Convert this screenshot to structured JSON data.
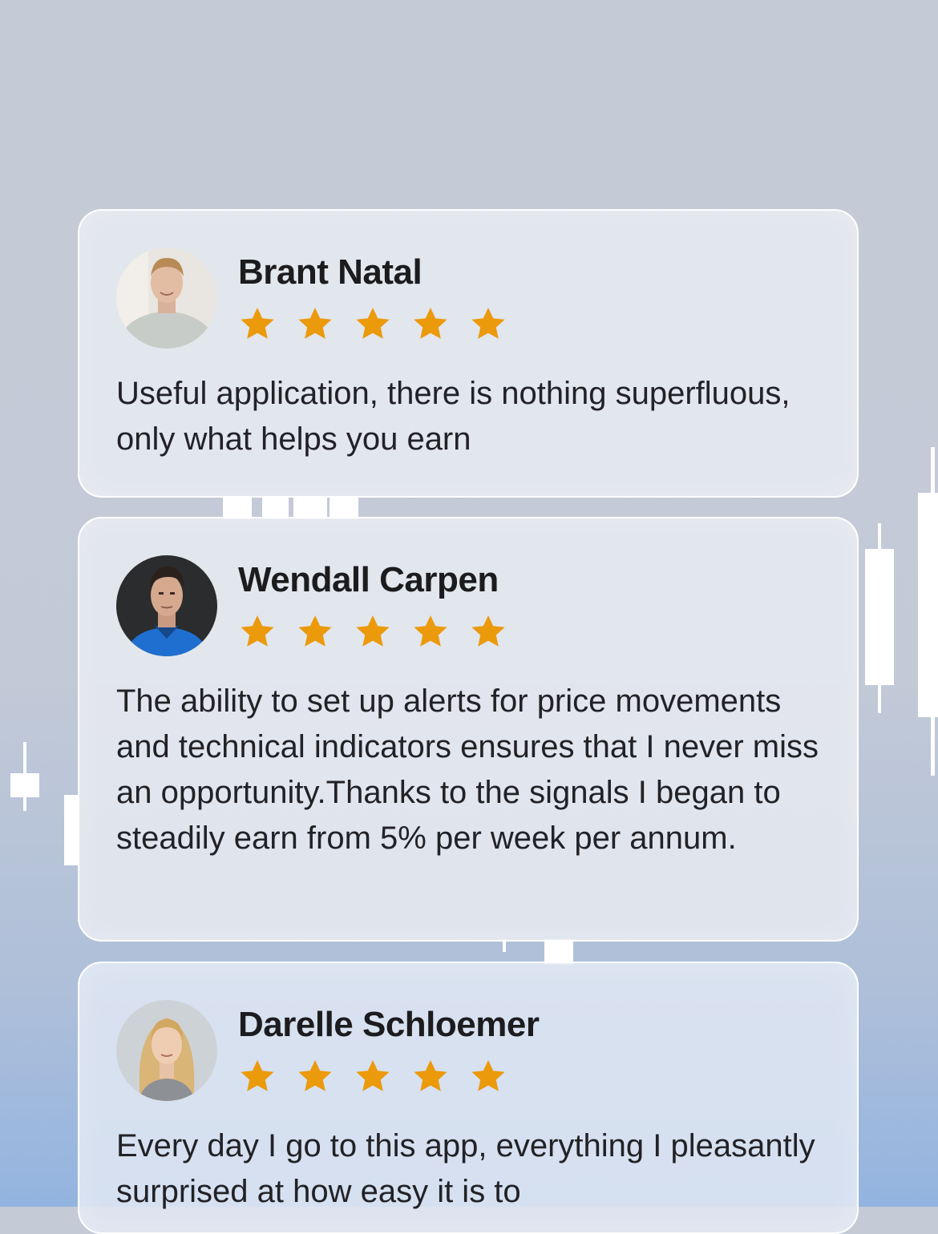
{
  "colors": {
    "star": "#eb9a0c",
    "card_border": "#ffffff",
    "text": "#222226"
  },
  "reviews": [
    {
      "name": "Brant Natal",
      "rating": 5,
      "text": "Useful application, there is nothing superfluous, only what helps you earn"
    },
    {
      "name": "Wendall Carpen",
      "rating": 5,
      "text": "The ability to set up alerts for price movements and technical indicators ensures that I never miss an opportunity.Thanks to the signals I began to steadily earn from 5% per week per annum."
    },
    {
      "name": "Darelle Schloemer",
      "rating": 5,
      "text": "Every day I go to this app, everything I pleasantly surprised at how easy it is to"
    }
  ]
}
